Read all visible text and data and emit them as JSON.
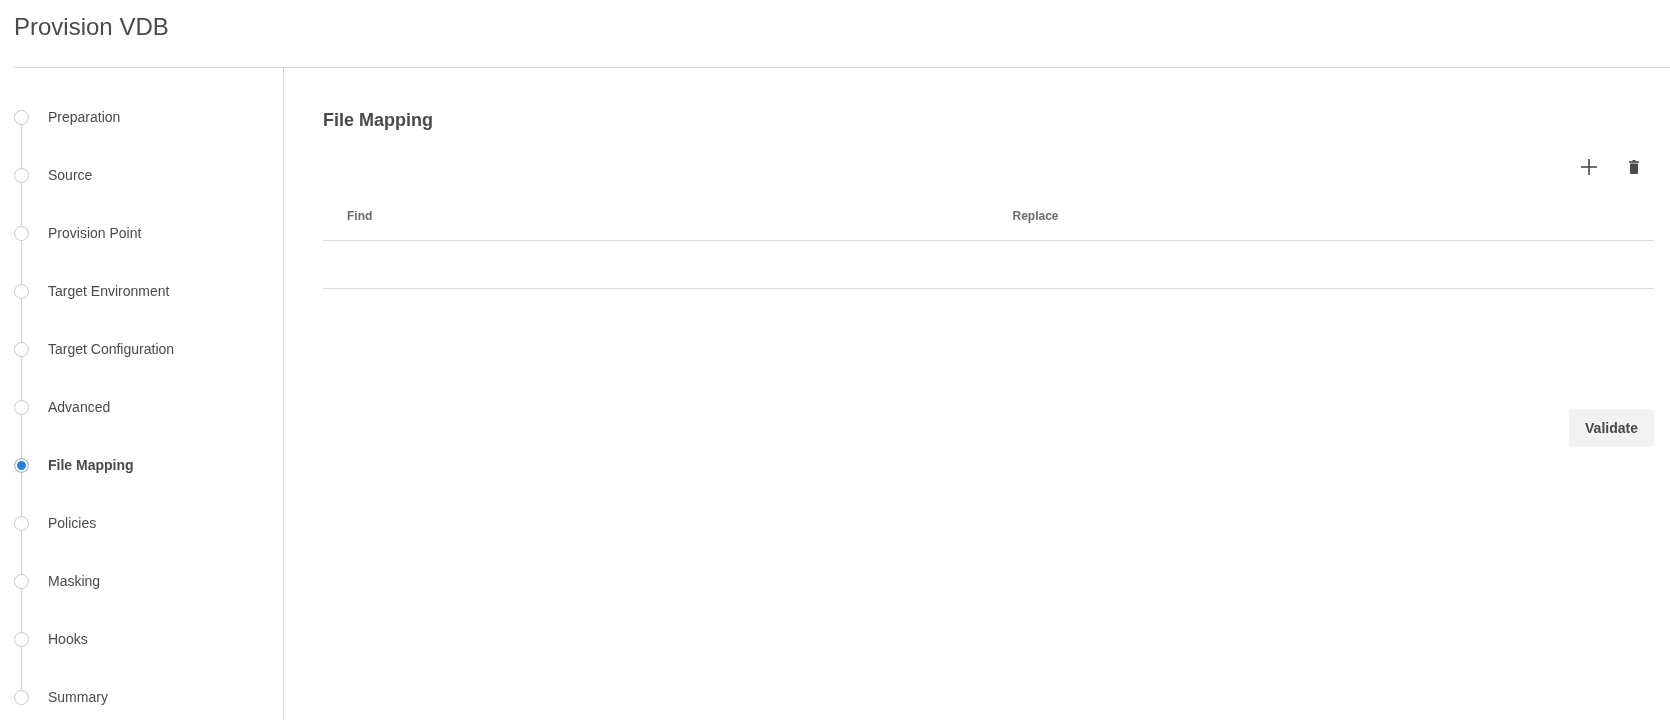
{
  "page": {
    "title": "Provision VDB"
  },
  "steps": [
    {
      "label": "Preparation",
      "selected": false
    },
    {
      "label": "Source",
      "selected": false
    },
    {
      "label": "Provision Point",
      "selected": false
    },
    {
      "label": "Target Environment",
      "selected": false
    },
    {
      "label": "Target Configuration",
      "selected": false
    },
    {
      "label": "Advanced",
      "selected": false
    },
    {
      "label": "File Mapping",
      "selected": true
    },
    {
      "label": "Policies",
      "selected": false
    },
    {
      "label": "Masking",
      "selected": false
    },
    {
      "label": "Hooks",
      "selected": false
    },
    {
      "label": "Summary",
      "selected": false
    }
  ],
  "section": {
    "title": "File Mapping"
  },
  "table": {
    "columns": [
      "Find",
      "Replace"
    ]
  },
  "validate_button": {
    "label": "Validate"
  }
}
